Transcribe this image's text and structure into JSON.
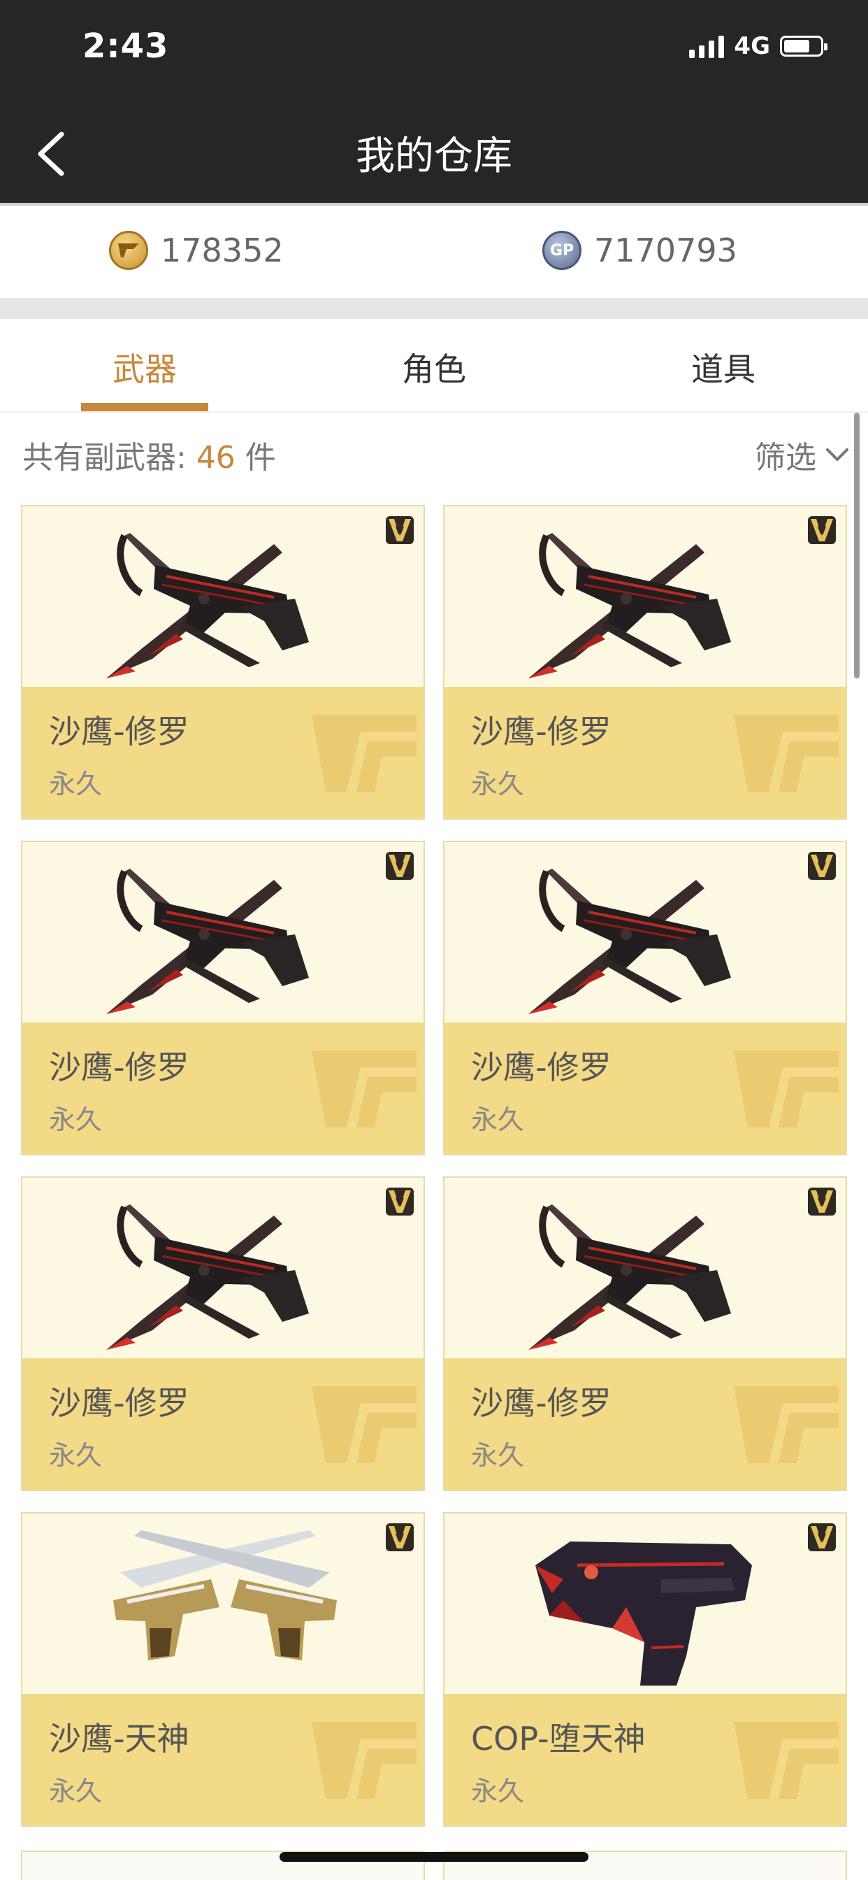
{
  "status_bar": {
    "time": "2:43",
    "network": "4G"
  },
  "nav": {
    "title": "我的仓库"
  },
  "currency": {
    "cf_points": "178352",
    "gp_points": "7170793",
    "gp_badge": "GP"
  },
  "tabs": [
    {
      "label": "武器",
      "active": true
    },
    {
      "label": "角色",
      "active": false
    },
    {
      "label": "道具",
      "active": false
    }
  ],
  "list_header": {
    "prefix": "共有副武器: ",
    "count": "46",
    "suffix": " 件",
    "filter_label": "筛选"
  },
  "vip_badge": "V",
  "items": [
    {
      "name": "沙鹰-修罗",
      "duration": "永久",
      "icon": "desert-eagle-asura"
    },
    {
      "name": "沙鹰-修罗",
      "duration": "永久",
      "icon": "desert-eagle-asura"
    },
    {
      "name": "沙鹰-修罗",
      "duration": "永久",
      "icon": "desert-eagle-asura"
    },
    {
      "name": "沙鹰-修罗",
      "duration": "永久",
      "icon": "desert-eagle-asura"
    },
    {
      "name": "沙鹰-修罗",
      "duration": "永久",
      "icon": "desert-eagle-asura"
    },
    {
      "name": "沙鹰-修罗",
      "duration": "永久",
      "icon": "desert-eagle-asura"
    },
    {
      "name": "沙鹰-天神",
      "duration": "永久",
      "icon": "desert-eagle-god"
    },
    {
      "name": "COP-堕天神",
      "duration": "永久",
      "icon": "cop-fallen-god"
    }
  ],
  "colors": {
    "accent": "#c8873a",
    "topbar": "#262626",
    "card_top": "#fdf8e2",
    "card_bottom": "#f2da87"
  }
}
